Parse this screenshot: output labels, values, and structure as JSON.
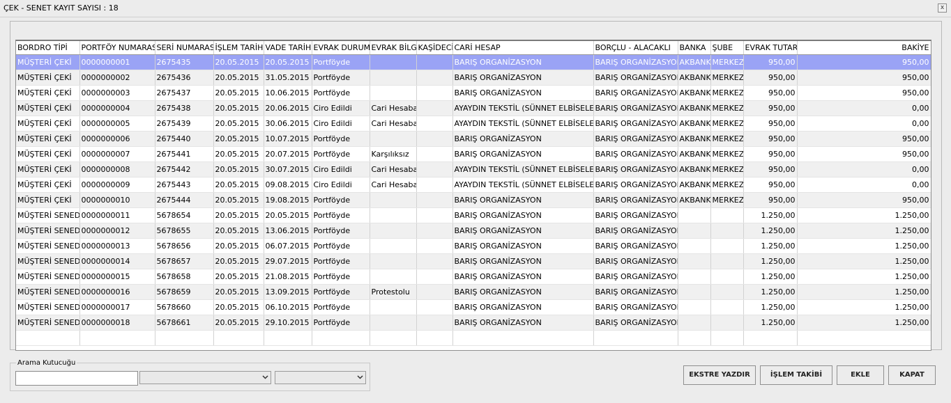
{
  "window": {
    "title": "ÇEK - SENET KAYIT SAYISI : 18",
    "close_glyph": "x"
  },
  "columns": [
    "BORDRO TİPİ",
    "PORTFÖY NUMARASI",
    "SERİ NUMARASI",
    "İŞLEM TARİHİ",
    "VADE TARİHİ",
    "EVRAK DURUMU",
    "EVRAK BİLGİ",
    "KAŞİDECİ",
    "CARİ HESAP",
    "BORÇLU - ALACAKLI",
    "BANKA",
    "ŞUBE",
    "EVRAK TUTARI",
    "BAKİYE"
  ],
  "rows": [
    [
      "MÜŞTERİ ÇEKİ",
      "0000000001",
      "2675435",
      "20.05.2015",
      "20.05.2015",
      "Portföyde",
      "",
      "",
      "BARIŞ ORGANİZASYON",
      "BARIŞ ORGANİZASYON",
      "AKBANK",
      "MERKEZ",
      "950,00",
      "950,00"
    ],
    [
      "MÜŞTERİ ÇEKİ",
      "0000000002",
      "2675436",
      "20.05.2015",
      "31.05.2015",
      "Portföyde",
      "",
      "",
      "BARIŞ ORGANİZASYON",
      "BARIŞ ORGANİZASYON",
      "AKBANK",
      "MERKEZ",
      "950,00",
      "950,00"
    ],
    [
      "MÜŞTERİ ÇEKİ",
      "0000000003",
      "2675437",
      "20.05.2015",
      "10.06.2015",
      "Portföyde",
      "",
      "",
      "BARIŞ ORGANİZASYON",
      "BARIŞ ORGANİZASYON",
      "AKBANK",
      "MERKEZ",
      "950,00",
      "950,00"
    ],
    [
      "MÜŞTERİ ÇEKİ",
      "0000000004",
      "2675438",
      "20.05.2015",
      "20.06.2015",
      "Ciro Edildi",
      "Cari Hesaba",
      "",
      "AYAYDIN TEKSTİL (SÜNNET ELBİSELERİ)",
      "BARIŞ ORGANİZASYON",
      "AKBANK",
      "MERKEZ",
      "950,00",
      "0,00"
    ],
    [
      "MÜŞTERİ ÇEKİ",
      "0000000005",
      "2675439",
      "20.05.2015",
      "30.06.2015",
      "Ciro Edildi",
      "Cari Hesaba",
      "",
      "AYAYDIN TEKSTİL (SÜNNET ELBİSELERİ)",
      "BARIŞ ORGANİZASYON",
      "AKBANK",
      "MERKEZ",
      "950,00",
      "0,00"
    ],
    [
      "MÜŞTERİ ÇEKİ",
      "0000000006",
      "2675440",
      "20.05.2015",
      "10.07.2015",
      "Portföyde",
      "",
      "",
      "BARIŞ ORGANİZASYON",
      "BARIŞ ORGANİZASYON",
      "AKBANK",
      "MERKEZ",
      "950,00",
      "950,00"
    ],
    [
      "MÜŞTERİ ÇEKİ",
      "0000000007",
      "2675441",
      "20.05.2015",
      "20.07.2015",
      "Portföyde",
      "Karşılıksız",
      "",
      "BARIŞ ORGANİZASYON",
      "BARIŞ ORGANİZASYON",
      "AKBANK",
      "MERKEZ",
      "950,00",
      "950,00"
    ],
    [
      "MÜŞTERİ ÇEKİ",
      "0000000008",
      "2675442",
      "20.05.2015",
      "30.07.2015",
      "Ciro Edildi",
      "Cari Hesaba",
      "",
      "AYAYDIN TEKSTİL (SÜNNET ELBİSELERİ)",
      "BARIŞ ORGANİZASYON",
      "AKBANK",
      "MERKEZ",
      "950,00",
      "0,00"
    ],
    [
      "MÜŞTERİ ÇEKİ",
      "0000000009",
      "2675443",
      "20.05.2015",
      "09.08.2015",
      "Ciro Edildi",
      "Cari Hesaba",
      "",
      "AYAYDIN TEKSTİL (SÜNNET ELBİSELERİ)",
      "BARIŞ ORGANİZASYON",
      "AKBANK",
      "MERKEZ",
      "950,00",
      "0,00"
    ],
    [
      "MÜŞTERİ ÇEKİ",
      "0000000010",
      "2675444",
      "20.05.2015",
      "19.08.2015",
      "Portföyde",
      "",
      "",
      "BARIŞ ORGANİZASYON",
      "BARIŞ ORGANİZASYON",
      "AKBANK",
      "MERKEZ",
      "950,00",
      "950,00"
    ],
    [
      "MÜŞTERİ SENEDİ",
      "0000000011",
      "5678654",
      "20.05.2015",
      "20.05.2015",
      "Portföyde",
      "",
      "",
      "BARIŞ ORGANİZASYON",
      "BARIŞ ORGANİZASYON",
      "",
      "",
      "1.250,00",
      "1.250,00"
    ],
    [
      "MÜŞTERİ SENEDİ",
      "0000000012",
      "5678655",
      "20.05.2015",
      "13.06.2015",
      "Portföyde",
      "",
      "",
      "BARIŞ ORGANİZASYON",
      "BARIŞ ORGANİZASYON",
      "",
      "",
      "1.250,00",
      "1.250,00"
    ],
    [
      "MÜŞTERİ SENEDİ",
      "0000000013",
      "5678656",
      "20.05.2015",
      "06.07.2015",
      "Portföyde",
      "",
      "",
      "BARIŞ ORGANİZASYON",
      "BARIŞ ORGANİZASYON",
      "",
      "",
      "1.250,00",
      "1.250,00"
    ],
    [
      "MÜŞTERİ SENEDİ",
      "0000000014",
      "5678657",
      "20.05.2015",
      "29.07.2015",
      "Portföyde",
      "",
      "",
      "BARIŞ ORGANİZASYON",
      "BARIŞ ORGANİZASYON",
      "",
      "",
      "1.250,00",
      "1.250,00"
    ],
    [
      "MÜŞTERİ SENEDİ",
      "0000000015",
      "5678658",
      "20.05.2015",
      "21.08.2015",
      "Portföyde",
      "",
      "",
      "BARIŞ ORGANİZASYON",
      "BARIŞ ORGANİZASYON",
      "",
      "",
      "1.250,00",
      "1.250,00"
    ],
    [
      "MÜŞTERİ SENEDİ",
      "0000000016",
      "5678659",
      "20.05.2015",
      "13.09.2015",
      "Portföyde",
      "Protestolu",
      "",
      "BARIŞ ORGANİZASYON",
      "BARIŞ ORGANİZASYON",
      "",
      "",
      "1.250,00",
      "1.250,00"
    ],
    [
      "MÜŞTERİ SENEDİ",
      "0000000017",
      "5678660",
      "20.05.2015",
      "06.10.2015",
      "Portföyde",
      "",
      "",
      "BARIŞ ORGANİZASYON",
      "BARIŞ ORGANİZASYON",
      "",
      "",
      "1.250,00",
      "1.250,00"
    ],
    [
      "MÜŞTERİ SENEDİ",
      "0000000018",
      "5678661",
      "20.05.2015",
      "29.10.2015",
      "Portföyde",
      "",
      "",
      "BARIŞ ORGANİZASYON",
      "BARIŞ ORGANİZASYON",
      "",
      "",
      "1.250,00",
      "1.250,00"
    ]
  ],
  "selected_row": 1,
  "search": {
    "label": "Arama Kutucuğu",
    "value": "",
    "combo1_value": "",
    "combo2_value": ""
  },
  "buttons": {
    "ekstre": "EKSTRE YAZDIR",
    "islem": "İŞLEM TAKİBİ",
    "ekle": "EKLE",
    "kapat": "KAPAT"
  },
  "colors": {
    "selection": "#9aa3f5",
    "alt_row": "#f0f0f0",
    "background": "#ececec"
  }
}
